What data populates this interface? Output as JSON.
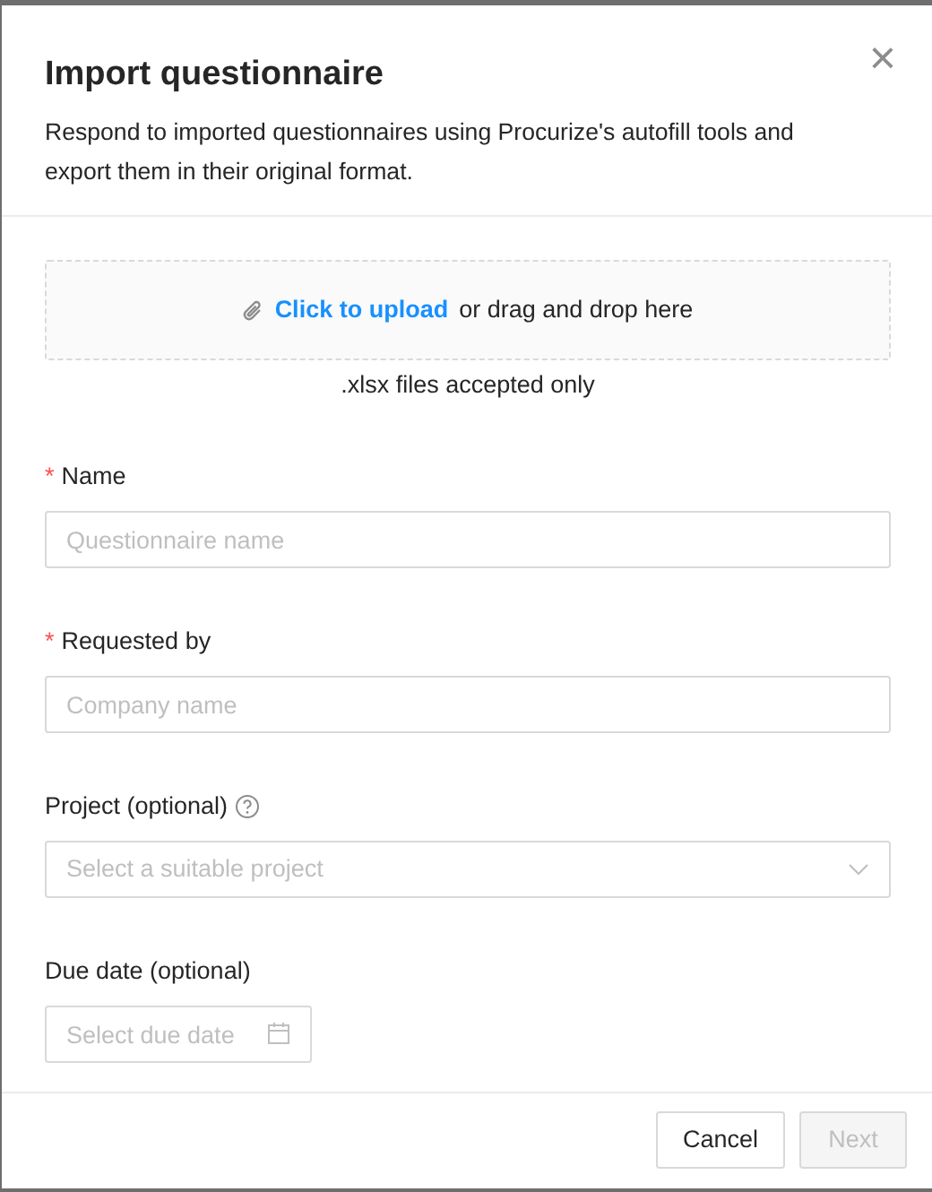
{
  "dialog": {
    "title": "Import questionnaire",
    "close": "×",
    "description": "Respond to imported questionnaires using Procurize's autofill tools and export them in their original format."
  },
  "upload": {
    "link": "Click to upload",
    "text": "or drag and drop here",
    "note": ".xlsx files accepted only"
  },
  "fields": [
    {
      "kind": "text",
      "label": "Name",
      "required_mark": "*",
      "placeholder": "Questionnaire name"
    },
    {
      "kind": "text",
      "label": "Requested by",
      "required_mark": "*",
      "placeholder": "Company name"
    },
    {
      "kind": "select",
      "label": "Project (optional)",
      "help": true,
      "placeholder": "Select a suitable project"
    },
    {
      "kind": "date",
      "label": "Due date (optional)",
      "placeholder": "Select due date"
    }
  ],
  "buttons": [
    {
      "label": "Cancel",
      "disabled": false
    },
    {
      "label": "Next",
      "disabled": true
    }
  ]
}
